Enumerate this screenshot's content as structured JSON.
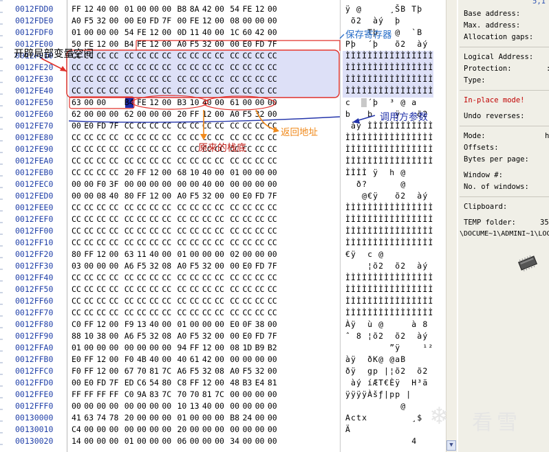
{
  "hex_rows": [
    {
      "addr": "0012FDD0",
      "bytes": [
        "FF",
        "12",
        "40",
        "00",
        "01",
        "00",
        "00",
        "00",
        "B8",
        "8A",
        "42",
        "00",
        "54",
        "FE",
        "12",
        "00"
      ],
      "ascii": "ÿ @     ¸ŠB Tþ "
    },
    {
      "addr": "0012FDE0",
      "bytes": [
        "A0",
        "F5",
        "32",
        "00",
        "00",
        "E0",
        "FD",
        "7F",
        "00",
        "FE",
        "12",
        "00",
        "08",
        "00",
        "00",
        "00"
      ],
      "ascii": " õ2  àý  þ     "
    },
    {
      "addr": "0012FDF0",
      "bytes": [
        "01",
        "00",
        "00",
        "00",
        "54",
        "FE",
        "12",
        "00",
        "0D",
        "11",
        "40",
        "00",
        "1C",
        "60",
        "42",
        "00"
      ],
      "ascii": "    Tþ   @  `B "
    },
    {
      "addr": "0012FE00",
      "bytes": [
        "50",
        "FE",
        "12",
        "00",
        "B4",
        "FE",
        "12",
        "00",
        "A0",
        "F5",
        "32",
        "00",
        "00",
        "E0",
        "FD",
        "7F"
      ],
      "ascii": "Pþ  ´þ   õ2  àý"
    },
    {
      "addr": "0012FE10",
      "bytes": [
        "CC",
        "CC",
        "CC",
        "CC",
        "CC",
        "CC",
        "CC",
        "CC",
        "CC",
        "CC",
        "CC",
        "CC",
        "CC",
        "CC",
        "CC",
        "CC"
      ],
      "ascii": "ÌÌÌÌÌÌÌÌÌÌÌÌÌÌÌÌ"
    },
    {
      "addr": "0012FE20",
      "bytes": [
        "CC",
        "CC",
        "CC",
        "CC",
        "CC",
        "CC",
        "CC",
        "CC",
        "CC",
        "CC",
        "CC",
        "CC",
        "CC",
        "CC",
        "CC",
        "CC"
      ],
      "ascii": "ÌÌÌÌÌÌÌÌÌÌÌÌÌÌÌÌ"
    },
    {
      "addr": "0012FE30",
      "bytes": [
        "CC",
        "CC",
        "CC",
        "CC",
        "CC",
        "CC",
        "CC",
        "CC",
        "CC",
        "CC",
        "CC",
        "CC",
        "CC",
        "CC",
        "CC",
        "CC"
      ],
      "ascii": "ÌÌÌÌÌÌÌÌÌÌÌÌÌÌÌÌ"
    },
    {
      "addr": "0012FE40",
      "bytes": [
        "CC",
        "CC",
        "CC",
        "CC",
        "CC",
        "CC",
        "CC",
        "CC",
        "CC",
        "CC",
        "CC",
        "CC",
        "CC",
        "CC",
        "CC",
        "CC"
      ],
      "ascii": "ÌÌÌÌÌÌÌÌÌÌÌÌÌÌÌÌ"
    },
    {
      "addr": "0012FE50",
      "bytes": [
        "63",
        "00",
        "00",
        "00",
        "B4",
        "FE",
        "12",
        "00",
        "B3",
        "10",
        "40",
        "00",
        "61",
        "00",
        "00",
        "00"
      ],
      "ascii": "c   ´þ  ³ @ a   "
    },
    {
      "addr": "0012FE60",
      "bytes": [
        "62",
        "00",
        "00",
        "00",
        "62",
        "00",
        "00",
        "00",
        "20",
        "FF",
        "12",
        "00",
        "A0",
        "F5",
        "32",
        "00"
      ],
      "ascii": "b   b    ÿ   õ2 "
    },
    {
      "addr": "0012FE70",
      "bytes": [
        "00",
        "E0",
        "FD",
        "7F",
        "CC",
        "CC",
        "CC",
        "CC",
        "CC",
        "CC",
        "CC",
        "CC",
        "CC",
        "CC",
        "CC",
        "CC"
      ],
      "ascii": " àý ÌÌÌÌÌÌÌÌÌÌÌÌ"
    },
    {
      "addr": "0012FE80",
      "bytes": [
        "CC",
        "CC",
        "CC",
        "CC",
        "CC",
        "CC",
        "CC",
        "CC",
        "CC",
        "CC",
        "CC",
        "CC",
        "CC",
        "CC",
        "CC",
        "CC"
      ],
      "ascii": "ÌÌÌÌÌÌÌÌÌÌÌÌÌÌÌÌ"
    },
    {
      "addr": "0012FE90",
      "bytes": [
        "CC",
        "CC",
        "CC",
        "CC",
        "CC",
        "CC",
        "CC",
        "CC",
        "CC",
        "CC",
        "CC",
        "CC",
        "CC",
        "CC",
        "CC",
        "CC"
      ],
      "ascii": "ÌÌÌÌÌÌÌÌÌÌÌÌÌÌÌÌ"
    },
    {
      "addr": "0012FEA0",
      "bytes": [
        "CC",
        "CC",
        "CC",
        "CC",
        "CC",
        "CC",
        "CC",
        "CC",
        "CC",
        "CC",
        "CC",
        "CC",
        "CC",
        "CC",
        "CC",
        "CC"
      ],
      "ascii": "ÌÌÌÌÌÌÌÌÌÌÌÌÌÌÌÌ"
    },
    {
      "addr": "0012FEB0",
      "bytes": [
        "CC",
        "CC",
        "CC",
        "CC",
        "20",
        "FF",
        "12",
        "00",
        "68",
        "10",
        "40",
        "00",
        "01",
        "00",
        "00",
        "00"
      ],
      "ascii": "ÌÌÌÌ ÿ  h @     "
    },
    {
      "addr": "0012FEC0",
      "bytes": [
        "00",
        "00",
        "F0",
        "3F",
        "00",
        "00",
        "00",
        "00",
        "00",
        "00",
        "40",
        "00",
        "00",
        "00",
        "00",
        "00"
      ],
      "ascii": "  ð?      @     "
    },
    {
      "addr": "0012FED0",
      "bytes": [
        "00",
        "00",
        "08",
        "40",
        "80",
        "FF",
        "12",
        "00",
        "A0",
        "F5",
        "32",
        "00",
        "00",
        "E0",
        "FD",
        "7F"
      ],
      "ascii": "   @€ÿ   õ2  àý "
    },
    {
      "addr": "0012FEE0",
      "bytes": [
        "CC",
        "CC",
        "CC",
        "CC",
        "CC",
        "CC",
        "CC",
        "CC",
        "CC",
        "CC",
        "CC",
        "CC",
        "CC",
        "CC",
        "CC",
        "CC"
      ],
      "ascii": "ÌÌÌÌÌÌÌÌÌÌÌÌÌÌÌÌ"
    },
    {
      "addr": "0012FEF0",
      "bytes": [
        "CC",
        "CC",
        "CC",
        "CC",
        "CC",
        "CC",
        "CC",
        "CC",
        "CC",
        "CC",
        "CC",
        "CC",
        "CC",
        "CC",
        "CC",
        "CC"
      ],
      "ascii": "ÌÌÌÌÌÌÌÌÌÌÌÌÌÌÌÌ"
    },
    {
      "addr": "0012FF00",
      "bytes": [
        "CC",
        "CC",
        "CC",
        "CC",
        "CC",
        "CC",
        "CC",
        "CC",
        "CC",
        "CC",
        "CC",
        "CC",
        "CC",
        "CC",
        "CC",
        "CC"
      ],
      "ascii": "ÌÌÌÌÌÌÌÌÌÌÌÌÌÌÌÌ"
    },
    {
      "addr": "0012FF10",
      "bytes": [
        "CC",
        "CC",
        "CC",
        "CC",
        "CC",
        "CC",
        "CC",
        "CC",
        "CC",
        "CC",
        "CC",
        "CC",
        "CC",
        "CC",
        "CC",
        "CC"
      ],
      "ascii": "ÌÌÌÌÌÌÌÌÌÌÌÌÌÌÌÌ"
    },
    {
      "addr": "0012FF20",
      "bytes": [
        "80",
        "FF",
        "12",
        "00",
        "63",
        "11",
        "40",
        "00",
        "01",
        "00",
        "00",
        "00",
        "02",
        "00",
        "00",
        "00"
      ],
      "ascii": "€ÿ  c @         "
    },
    {
      "addr": "0012FF30",
      "bytes": [
        "03",
        "00",
        "00",
        "00",
        "A6",
        "F5",
        "32",
        "08",
        "A0",
        "F5",
        "32",
        "00",
        "00",
        "E0",
        "FD",
        "7F"
      ],
      "ascii": "    ¦õ2  õ2  àý "
    },
    {
      "addr": "0012FF40",
      "bytes": [
        "CC",
        "CC",
        "CC",
        "CC",
        "CC",
        "CC",
        "CC",
        "CC",
        "CC",
        "CC",
        "CC",
        "CC",
        "CC",
        "CC",
        "CC",
        "CC"
      ],
      "ascii": "ÌÌÌÌÌÌÌÌÌÌÌÌÌÌÌÌ"
    },
    {
      "addr": "0012FF50",
      "bytes": [
        "CC",
        "CC",
        "CC",
        "CC",
        "CC",
        "CC",
        "CC",
        "CC",
        "CC",
        "CC",
        "CC",
        "CC",
        "CC",
        "CC",
        "CC",
        "CC"
      ],
      "ascii": "ÌÌÌÌÌÌÌÌÌÌÌÌÌÌÌÌ"
    },
    {
      "addr": "0012FF60",
      "bytes": [
        "CC",
        "CC",
        "CC",
        "CC",
        "CC",
        "CC",
        "CC",
        "CC",
        "CC",
        "CC",
        "CC",
        "CC",
        "CC",
        "CC",
        "CC",
        "CC"
      ],
      "ascii": "ÌÌÌÌÌÌÌÌÌÌÌÌÌÌÌÌ"
    },
    {
      "addr": "0012FF70",
      "bytes": [
        "CC",
        "CC",
        "CC",
        "CC",
        "CC",
        "CC",
        "CC",
        "CC",
        "CC",
        "CC",
        "CC",
        "CC",
        "CC",
        "CC",
        "CC",
        "CC"
      ],
      "ascii": "ÌÌÌÌÌÌÌÌÌÌÌÌÌÌÌÌ"
    },
    {
      "addr": "0012FF80",
      "bytes": [
        "C0",
        "FF",
        "12",
        "00",
        "F9",
        "13",
        "40",
        "00",
        "01",
        "00",
        "00",
        "00",
        "E0",
        "0F",
        "38",
        "00"
      ],
      "ascii": "Àÿ  ù @     à 8 "
    },
    {
      "addr": "0012FF90",
      "bytes": [
        "88",
        "10",
        "38",
        "00",
        "A6",
        "F5",
        "32",
        "08",
        "A0",
        "F5",
        "32",
        "00",
        "00",
        "E0",
        "FD",
        "7F"
      ],
      "ascii": "ˆ 8 ¦õ2  õ2  àý "
    },
    {
      "addr": "0012FFA0",
      "bytes": [
        "01",
        "00",
        "00",
        "00",
        "00",
        "00",
        "00",
        "00",
        "94",
        "FF",
        "12",
        "00",
        "08",
        "1D",
        "B9",
        "B2"
      ],
      "ascii": "        ”ÿ    ¹²"
    },
    {
      "addr": "0012FFB0",
      "bytes": [
        "E0",
        "FF",
        "12",
        "00",
        "F0",
        "4B",
        "40",
        "00",
        "40",
        "61",
        "42",
        "00",
        "00",
        "00",
        "00",
        "00"
      ],
      "ascii": "àÿ  ðK@ @aB     "
    },
    {
      "addr": "0012FFC0",
      "bytes": [
        "F0",
        "FF",
        "12",
        "00",
        "67",
        "70",
        "81",
        "7C",
        "A6",
        "F5",
        "32",
        "08",
        "A0",
        "F5",
        "32",
        "00"
      ],
      "ascii": "ðÿ  gp |¦õ2  õ2 "
    },
    {
      "addr": "0012FFD0",
      "bytes": [
        "00",
        "E0",
        "FD",
        "7F",
        "ED",
        "C6",
        "54",
        "80",
        "C8",
        "FF",
        "12",
        "00",
        "48",
        "B3",
        "E4",
        "81"
      ],
      "ascii": " àý íÆT€Èÿ  H³ä "
    },
    {
      "addr": "0012FFE0",
      "bytes": [
        "FF",
        "FF",
        "FF",
        "FF",
        "C0",
        "9A",
        "83",
        "7C",
        "70",
        "70",
        "81",
        "7C",
        "00",
        "00",
        "00",
        "00"
      ],
      "ascii": "ÿÿÿÿÀšƒ|pp |    "
    },
    {
      "addr": "0012FFF0",
      "bytes": [
        "00",
        "00",
        "00",
        "00",
        "00",
        "00",
        "00",
        "00",
        "10",
        "13",
        "40",
        "00",
        "00",
        "00",
        "00",
        "00"
      ],
      "ascii": "          @     "
    },
    {
      "addr": "00130000",
      "bytes": [
        "41",
        "63",
        "74",
        "78",
        "20",
        "00",
        "00",
        "00",
        "01",
        "00",
        "00",
        "00",
        "B8",
        "24",
        "00",
        "00"
      ],
      "ascii": "Actx        ¸$  "
    },
    {
      "addr": "00130010",
      "bytes": [
        "C4",
        "00",
        "00",
        "00",
        "00",
        "00",
        "00",
        "00",
        "20",
        "00",
        "00",
        "00",
        "00",
        "00",
        "00",
        "00"
      ],
      "ascii": "Ä               "
    },
    {
      "addr": "00130020",
      "bytes": [
        "14",
        "00",
        "00",
        "00",
        "01",
        "00",
        "00",
        "00",
        "06",
        "00",
        "00",
        "00",
        "34",
        "00",
        "00",
        "00"
      ],
      "ascii": "            4   "
    }
  ],
  "info_panel": {
    "top_value": "5,1",
    "base_address": "Base address:",
    "max_address": "Max. address:",
    "allocation_gaps": "Allocation gaps:",
    "logical_address": "Logical Address:",
    "protection": "Protection:",
    "protection_value": ":",
    "type": "Type:",
    "in_place_mode": "In-place mode!",
    "undo_reverses": "Undo reverses:",
    "mode": "Mode:",
    "mode_value": "h",
    "offsets": "Offsets:",
    "bytes_per_page": "Bytes per page:",
    "window_no": "Window #:",
    "no_of_windows": "No. of windows:",
    "clipboard": "Clipboard:",
    "temp_folder": "TEMP folder:",
    "temp_folder_value": "35",
    "temp_path": "\\DOCUME~1\\ADMINI~1\\LOC"
  },
  "annotations": {
    "save_register": "保存寄存器",
    "local_var_space": "开辟局部变量空间",
    "caller_params": "调用方参数",
    "return_address": "返回地址",
    "original_stack_bottom": "原来的栈底"
  },
  "watermark": {
    "text": "看雪"
  },
  "colors": {
    "address_blue": "#1f3fa8",
    "selection": "#dde0f7",
    "annotation_red": "#e0302a",
    "annotation_blue": "#2a6fc9",
    "annotation_orange": "#f08a1c",
    "annotation_darkred": "#c0201a",
    "annotation_navy": "#2233aa",
    "info_red": "#c00000"
  }
}
